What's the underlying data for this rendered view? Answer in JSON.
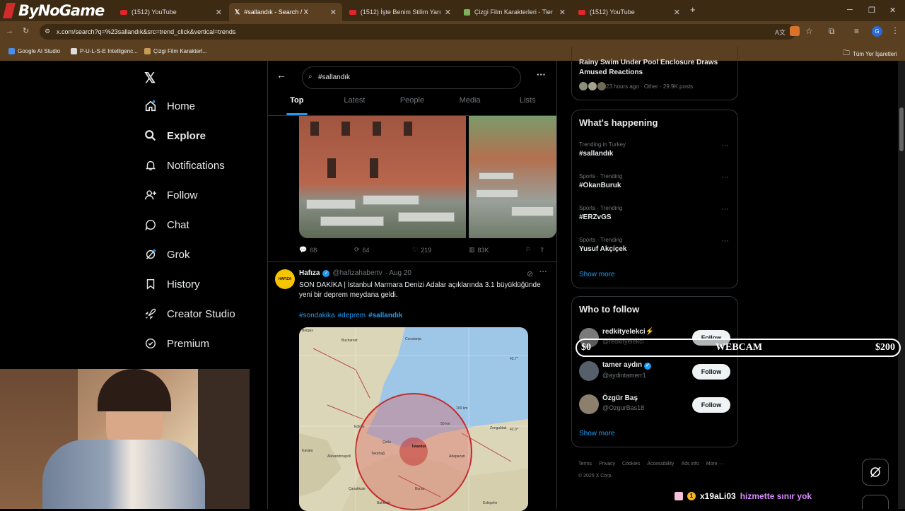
{
  "browser": {
    "brand": "ByNoGame",
    "tabs": [
      {
        "label": "(1512) YouTube"
      },
      {
        "label": "#sallandık - Search / X"
      },
      {
        "label": "(1512) İşte Benim Stilim Yarışma"
      },
      {
        "label": "Çizgi Film Karakterleri - Tier List"
      },
      {
        "label": "(1512) YouTube"
      }
    ],
    "url": "x.com/search?q=%23sallandık&src=trend_click&vertical=trends",
    "bookmarks": [
      "Google AI Studio",
      "P-U-L-S-E Intelligenc...",
      "Çizgi Film Karakterl..."
    ],
    "all_bookmarks": "Tüm Yer İşaretleri",
    "profile_initial": "G"
  },
  "nav": {
    "items": [
      "Home",
      "Explore",
      "Notifications",
      "Follow",
      "Chat",
      "Grok",
      "History",
      "Creator Studio",
      "Premium"
    ]
  },
  "search": {
    "query": "#sallandık",
    "tabs": [
      "Top",
      "Latest",
      "People",
      "Media",
      "Lists"
    ]
  },
  "tweet1": {
    "replies": "68",
    "retweets": "64",
    "likes": "219",
    "views": "83K"
  },
  "tweet2": {
    "author": "Hafıza",
    "handle": "@hafizahabertv",
    "date": "· Aug 20",
    "avatar_text": "HAFIZA",
    "text": "SON DAKİKA | İstanbul Marmara Denizi Adalar açıklarında 3.1 büyüklüğünde yeni bir deprem meydana geldi.",
    "hashtags": [
      "#sondakika",
      "#deprem",
      "#sallandık"
    ],
    "map_labels": [
      "Burgas",
      "Edirne",
      "Çorlu",
      "İstanbul",
      "Tekirdağ",
      "Bursa",
      "Adapazarı",
      "Kavala",
      "Alexandroupoli",
      "Çanakkale",
      "Balıkesir",
      "Eskişehir",
      "Zonguldak",
      "Constanța",
      "Bucharest"
    ],
    "map_grid_labels": [
      "43.7°",
      "42.0°",
      "100 km",
      "50 km"
    ]
  },
  "right": {
    "prev_story": "Rainy Swim Under Pool Enclosure Draws Amused Reactions",
    "prev_meta": "23 hours ago · Other · 29.9K posts",
    "happening_title": "What's happening",
    "trends": [
      {
        "meta": "Trending in Turkey",
        "name": "#sallandık"
      },
      {
        "meta": "Sports · Trending",
        "name": "#OkanBuruk"
      },
      {
        "meta": "Sports · Trending",
        "name": "#ERZvGS"
      },
      {
        "meta": "Sports · Trending",
        "name": "Yusuf Akçiçek"
      }
    ],
    "show_more": "Show more",
    "wtf_title": "Who to follow",
    "who_to_follow": [
      {
        "name": "redkityelekci⚡",
        "handle": "@redkityelekci"
      },
      {
        "name": "tamer aydın",
        "handle": "@aydintamerr1"
      },
      {
        "name": "Özgür Baş",
        "handle": "@OzgurBas18"
      }
    ],
    "follow_label": "Follow",
    "footer": [
      "Terms",
      "Privacy",
      "Cookies",
      "Accessibility",
      "Ads info",
      "More ···",
      "© 2025 X Corp."
    ]
  },
  "overlay": {
    "left": "$0",
    "center": "WEBCAM",
    "right": "$200"
  },
  "chat": {
    "badge": "1",
    "user": "x19aLi03",
    "message": "hizmette sınır yok"
  },
  "colors": {
    "accent": "#1d9bf0",
    "chrome": "#5a4021",
    "chat_message": "#d88cff"
  }
}
